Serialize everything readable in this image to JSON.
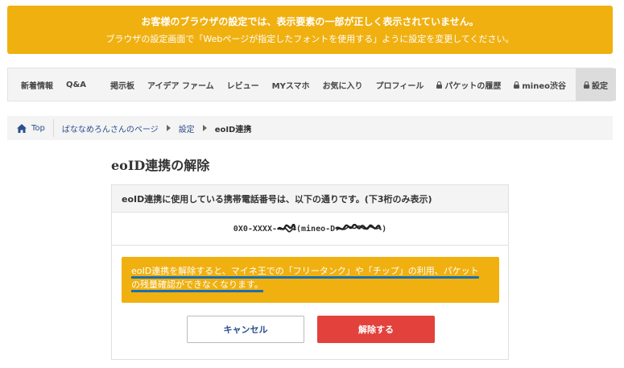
{
  "banner": {
    "line1": "お客様のブラウザの設定では、表示要素の一部が正しく表示されていません。",
    "line2": "ブラウザの設定画面で「Webページが指定したフォントを使用する」ように設定を変更してください。"
  },
  "nav": {
    "items": [
      {
        "label": "新着情報",
        "locked": false
      },
      {
        "label": "Q&A",
        "locked": false
      },
      {
        "label": "掲示板",
        "locked": false
      },
      {
        "label": "アイデア ファーム",
        "locked": false
      },
      {
        "label": "レビュー",
        "locked": false
      },
      {
        "label": "MYスマホ",
        "locked": false
      },
      {
        "label": "お気に入り",
        "locked": false
      },
      {
        "label": "プロフィール",
        "locked": false
      },
      {
        "label": "パケットの履歴",
        "locked": true
      },
      {
        "label": "mineo渋谷",
        "locked": true
      },
      {
        "label": "設定",
        "locked": true,
        "active": true
      }
    ]
  },
  "breadcrumb": {
    "home": "Top",
    "user_page": "ばななめろんさんのページ",
    "settings": "設定",
    "current": "eoID連携"
  },
  "page": {
    "title": "eoID連携の解除"
  },
  "panel": {
    "header": "eoID連携に使用している携帯電話番号は、以下の通りです。(下3桁のみ表示)",
    "phone_prefix": "0X0-XXXX-",
    "phone_mid": "(mineo-D",
    "phone_suffix": ")",
    "warning_line1": "eoID連携を解除すると、マイネ王での「フリータンク」や「チップ」の利用、パケット",
    "warning_line2": "の残量確認ができなくなります。",
    "cancel_label": "キャンセル",
    "confirm_label": "解除する"
  },
  "colors": {
    "accent_yellow": "#f0b010",
    "danger_red": "#e3413b",
    "link_blue": "#2a4f8c"
  }
}
